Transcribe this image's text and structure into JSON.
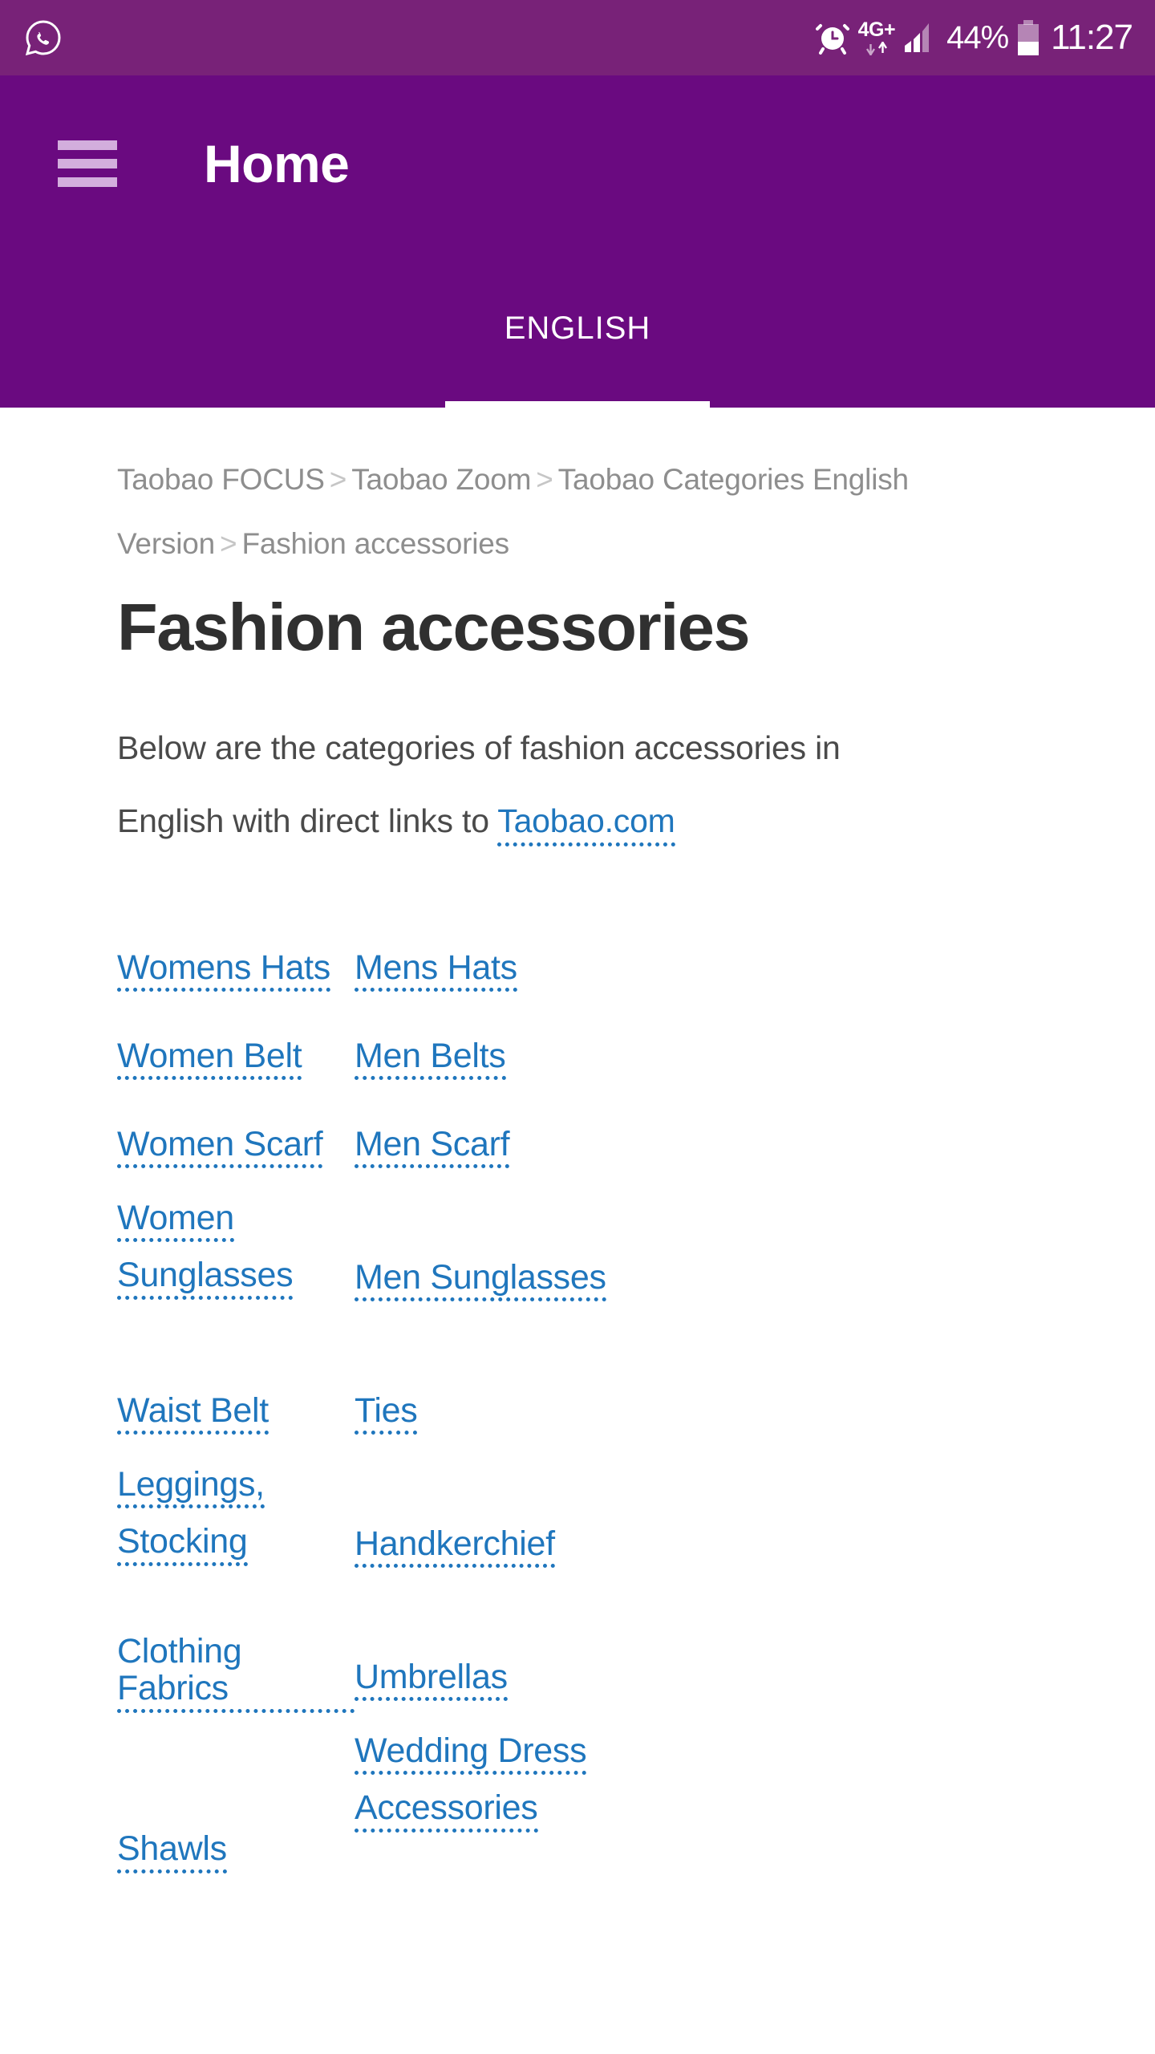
{
  "status_bar": {
    "app_icon": "whatsapp-icon",
    "alarm_icon": "alarm-clock-icon",
    "network_type": "4G+",
    "signal_icon": "signal-bars-icon",
    "battery_percent": "44%",
    "battery_icon": "battery-icon",
    "time": "11:27"
  },
  "header": {
    "menu_icon": "hamburger-menu-icon",
    "title": "Home",
    "tabs": [
      {
        "label": "ENGLISH",
        "active": true
      }
    ]
  },
  "breadcrumb": {
    "separator": ">",
    "items": [
      "Taobao FOCUS",
      "Taobao Zoom",
      "Taobao Categories English Version",
      "Fashion accessories"
    ]
  },
  "main": {
    "heading": "Fashion accessories",
    "intro_text": "Below are the categories of fashion accessories in English with direct links to",
    "intro_link": "Taobao.com"
  },
  "categories": {
    "left_column": [
      {
        "label": "Womens Hats",
        "lines": [
          "Womens Hats"
        ]
      },
      {
        "label": "Women Belt",
        "lines": [
          "Women Belt"
        ]
      },
      {
        "label": "Women Scarf",
        "lines": [
          "Women Scarf"
        ]
      },
      {
        "label": "Women Sunglasses",
        "lines": [
          "Women",
          "Sunglasses"
        ]
      },
      {
        "label": "Waist Belt",
        "lines": [
          "Waist Belt"
        ]
      },
      {
        "label": "Leggings, Stocking",
        "lines": [
          "Leggings,",
          "Stocking"
        ]
      },
      {
        "label": "Clothing Fabrics",
        "lines": [
          "Clothing Fabrics"
        ]
      },
      {
        "label": "Shawls",
        "lines": [
          "Shawls"
        ]
      }
    ],
    "right_column": [
      {
        "label": "Mens Hats",
        "lines": [
          "Mens Hats"
        ]
      },
      {
        "label": "Men Belts",
        "lines": [
          "Men Belts"
        ]
      },
      {
        "label": "Men Scarf",
        "lines": [
          "Men Scarf"
        ]
      },
      {
        "label": "Men Sunglasses",
        "lines": [
          "Men Sunglasses"
        ]
      },
      {
        "label": "Ties",
        "lines": [
          "Ties"
        ]
      },
      {
        "label": "Handkerchief",
        "lines": [
          "Handkerchief"
        ]
      },
      {
        "label": "Umbrellas",
        "lines": [
          "Umbrellas"
        ]
      },
      {
        "label": "Wedding Dress Accessories",
        "lines": [
          "Wedding Dress",
          "Accessories"
        ]
      }
    ]
  },
  "colors": {
    "status_bar_purple": "#782278",
    "header_purple": "#6A0A80",
    "link_blue": "#1F76BD",
    "heading_dark": "#303030",
    "body_gray": "#4A4A4A",
    "breadcrumb_gray": "#8E8E8E",
    "menu_icon_purple": "#D3AEDD",
    "page_background": "#FFFFFF"
  }
}
